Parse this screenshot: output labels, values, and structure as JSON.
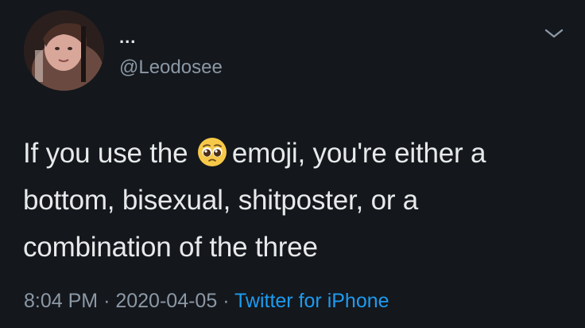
{
  "tweet": {
    "display_name": "...",
    "handle": "@Leodosee",
    "text_before_emoji": "If you use the",
    "emoji": "pleading-face-emoji",
    "text_after_emoji": "emoji, you're either a bottom, bisexual, shitposter, or a combination of the three",
    "time": "8:04 PM",
    "separator": "·",
    "date": "2020-04-05",
    "source": "Twitter for iPhone"
  },
  "icons": {
    "more": "chevron-down-icon",
    "avatar": "profile-photo"
  },
  "colors": {
    "background": "#14171c",
    "text": "#e7e9ea",
    "secondary": "#8b98a5",
    "link": "#1d9bf0"
  }
}
